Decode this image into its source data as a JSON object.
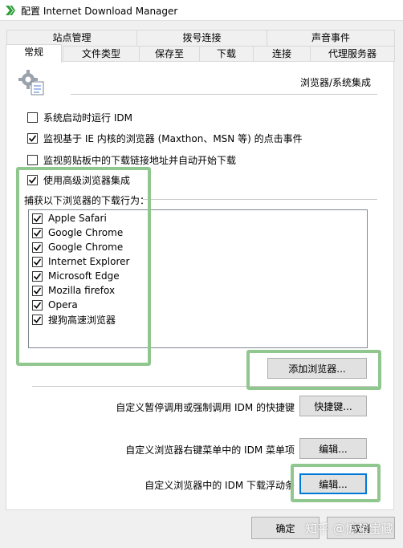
{
  "window": {
    "title": "配置 Internet Download Manager"
  },
  "tabs_back_row": [
    "站点管理",
    "拨号连接",
    "声音事件"
  ],
  "tabs_front_row": [
    "常规",
    "文件类型",
    "保存至",
    "下载",
    "连接",
    "代理服务器"
  ],
  "active_tab": "常规",
  "section_title": "浏览器/系统集成",
  "options": [
    {
      "label": "系统启动时运行 IDM",
      "checked": false
    },
    {
      "label": "监视基于 IE 内核的浏览器 (Maxthon、MSN 等) 的点击事件",
      "checked": true
    },
    {
      "label": "监视剪贴板中的下载链接地址并自动开始下载",
      "checked": false
    },
    {
      "label": "使用高级浏览器集成",
      "checked": true
    }
  ],
  "capture_caption": "捕获以下浏览器的下载行为：",
  "browsers": [
    {
      "label": "Apple Safari",
      "checked": true
    },
    {
      "label": "Google Chrome",
      "checked": true
    },
    {
      "label": "Google Chrome",
      "checked": true
    },
    {
      "label": "Internet Explorer",
      "checked": true
    },
    {
      "label": "Microsoft Edge",
      "checked": true
    },
    {
      "label": "Mozilla firefox",
      "checked": true
    },
    {
      "label": "Opera",
      "checked": true
    },
    {
      "label": "搜狗高速浏览器",
      "checked": true
    }
  ],
  "add_browser_button": "添加浏览器...",
  "hotkey_row": {
    "label": "自定义暂停调用或强制调用 IDM 的快捷键",
    "button": "快捷键..."
  },
  "context_menu_row": {
    "label": "自定义浏览器右键菜单中的 IDM 菜单项",
    "button": "编辑..."
  },
  "download_bar_row": {
    "label": "自定义浏览器中的 IDM 下载浮动条",
    "button": "编辑..."
  },
  "footer": {
    "ok_button": "确定",
    "cancel_button": "取消"
  },
  "watermark": "知乎 @惊蛰宝藏",
  "colors": {
    "highlight": "#8fc78f",
    "focus": "#0078d7",
    "app_icon": "#2e9e3a"
  }
}
